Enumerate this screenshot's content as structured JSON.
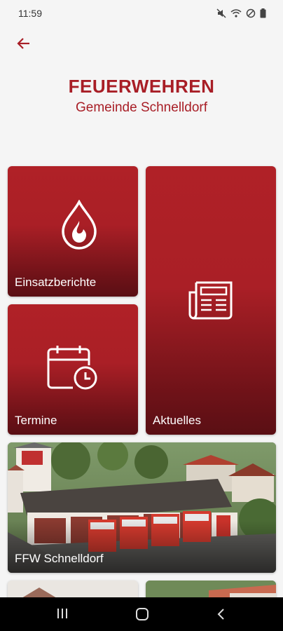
{
  "status_bar": {
    "time": "11:59"
  },
  "header": {
    "title": "FEUERWEHREN",
    "subtitle": "Gemeinde Schnelldorf"
  },
  "tiles": {
    "einsatzberichte": "Einsatzberichte",
    "termine": "Termine",
    "aktuelles": "Aktuelles",
    "ffw_schnelldorf": "FFW Schnelldorf"
  },
  "colors": {
    "brand_red": "#a81e26",
    "tile_dark": "#5a0f14",
    "background": "#f5f5f5"
  }
}
